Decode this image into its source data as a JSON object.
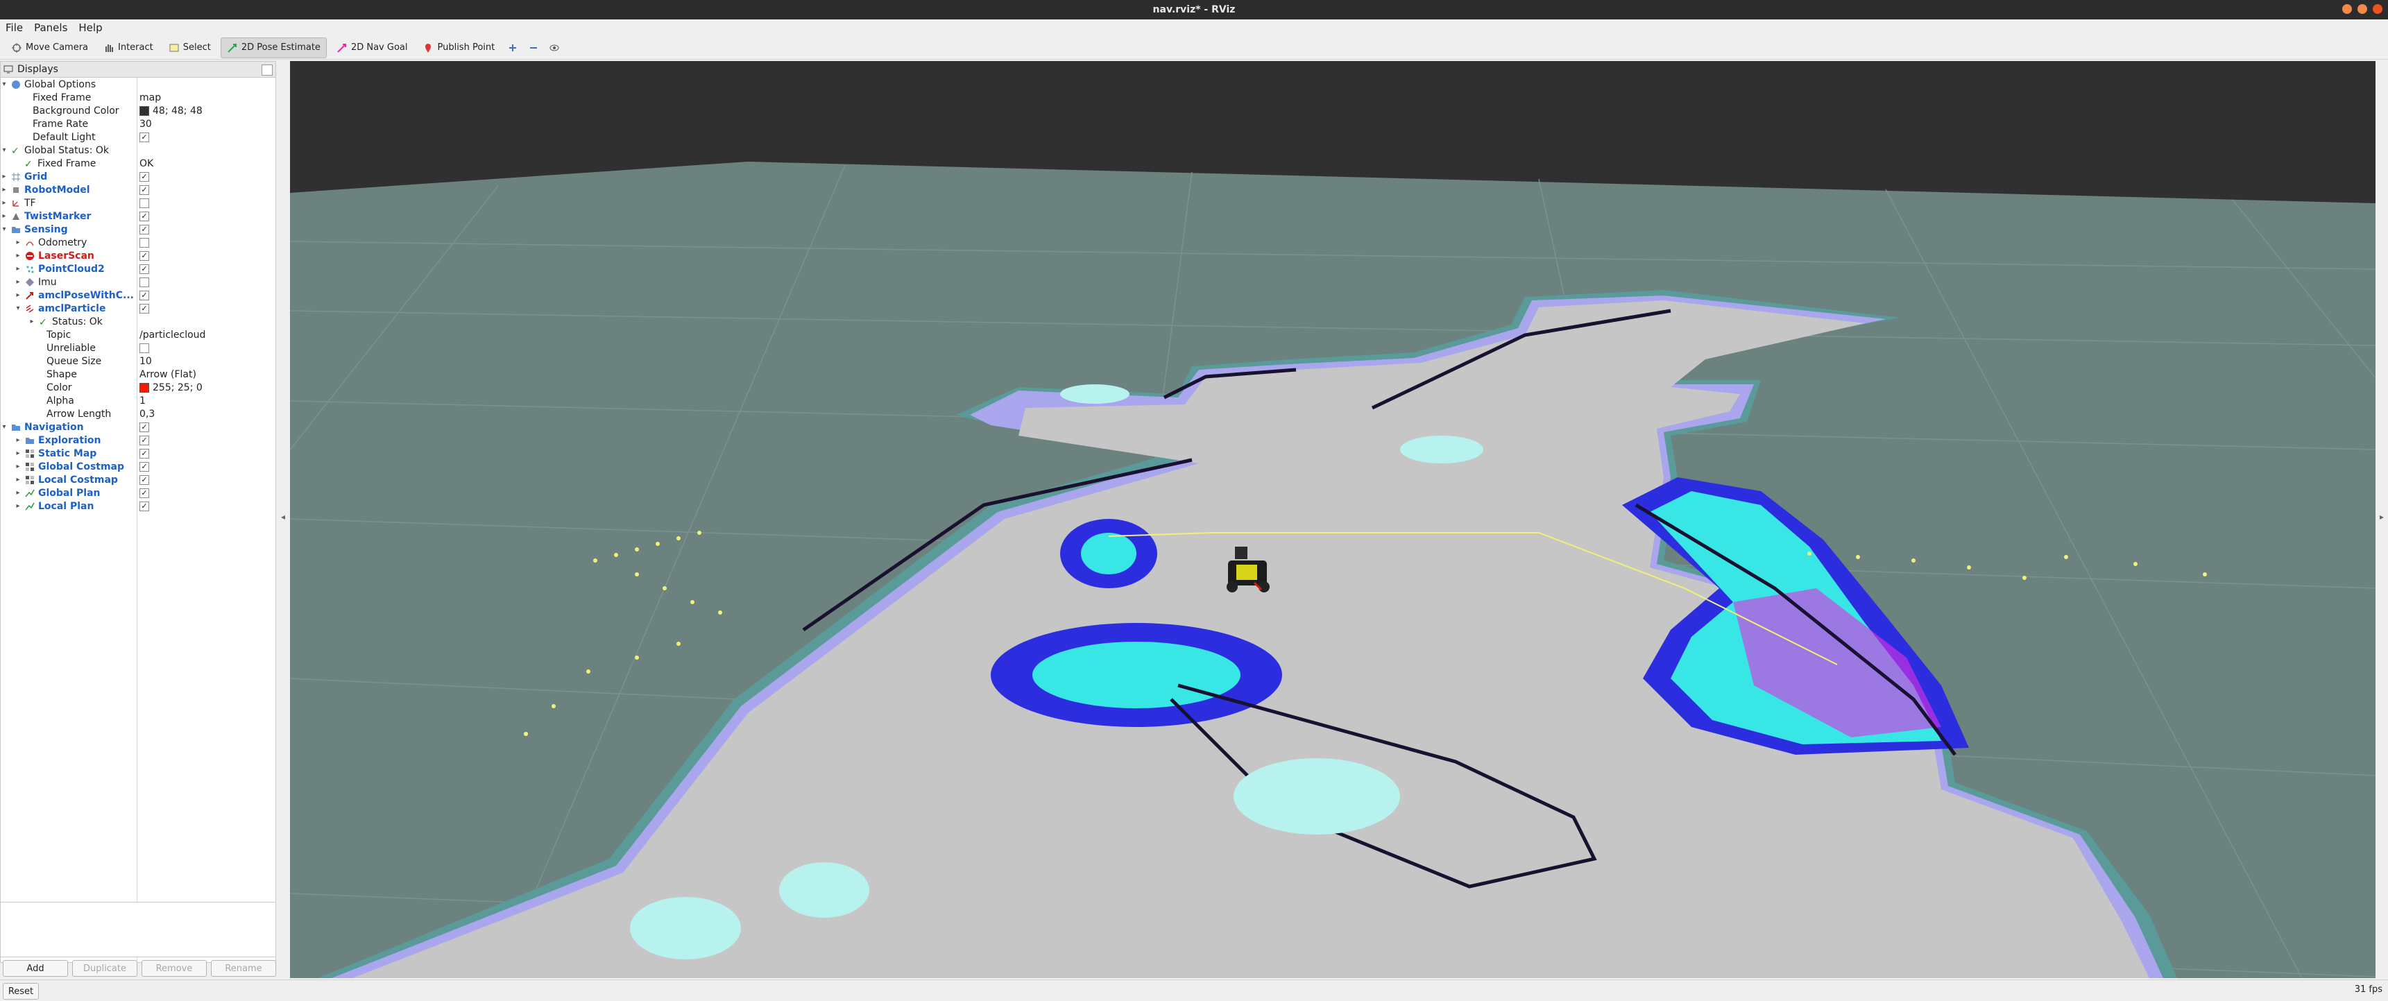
{
  "window": {
    "title": "nav.rviz* - RViz"
  },
  "menu": [
    "File",
    "Panels",
    "Help"
  ],
  "toolbar": {
    "move_camera": "Move Camera",
    "interact": "Interact",
    "select": "Select",
    "pose_estimate": "2D Pose Estimate",
    "nav_goal": "2D Nav Goal",
    "publish_point": "Publish Point"
  },
  "displays": {
    "title": "Displays",
    "rows": [
      {
        "name": "Global Options",
        "value": ""
      },
      {
        "name": "Fixed Frame",
        "value": "map"
      },
      {
        "name": "Background Color",
        "value": "48; 48; 48"
      },
      {
        "name": "Frame Rate",
        "value": "30"
      },
      {
        "name": "Default Light",
        "value": ""
      },
      {
        "name": "Global Status: Ok",
        "value": ""
      },
      {
        "name": "Fixed Frame",
        "value": "OK"
      },
      {
        "name": "Grid",
        "value": ""
      },
      {
        "name": "RobotModel",
        "value": ""
      },
      {
        "name": "TF",
        "value": ""
      },
      {
        "name": "TwistMarker",
        "value": ""
      },
      {
        "name": "Sensing",
        "value": ""
      },
      {
        "name": "Odometry",
        "value": ""
      },
      {
        "name": "LaserScan",
        "value": ""
      },
      {
        "name": "PointCloud2",
        "value": ""
      },
      {
        "name": "Imu",
        "value": ""
      },
      {
        "name": "amclPoseWithC...",
        "value": ""
      },
      {
        "name": "amclParticle",
        "value": ""
      },
      {
        "name": "Status: Ok",
        "value": ""
      },
      {
        "name": "Topic",
        "value": "/particlecloud"
      },
      {
        "name": "Unreliable",
        "value": ""
      },
      {
        "name": "Queue Size",
        "value": "10"
      },
      {
        "name": "Shape",
        "value": "Arrow (Flat)"
      },
      {
        "name": "Color",
        "value": "255; 25; 0"
      },
      {
        "name": "Alpha",
        "value": "1"
      },
      {
        "name": "Arrow Length",
        "value": "0,3"
      },
      {
        "name": "Navigation",
        "value": ""
      },
      {
        "name": "Exploration",
        "value": ""
      },
      {
        "name": "Static Map",
        "value": ""
      },
      {
        "name": "Global Costmap",
        "value": ""
      },
      {
        "name": "Local Costmap",
        "value": ""
      },
      {
        "name": "Global Plan",
        "value": ""
      },
      {
        "name": "Local Plan",
        "value": ""
      }
    ],
    "buttons": {
      "add": "Add",
      "duplicate": "Duplicate",
      "remove": "Remove",
      "rename": "Rename"
    }
  },
  "colors": {
    "background_swatch": "#303030",
    "particle_swatch": "#ff1900",
    "accent_blue": "#1d60c8",
    "viewport_floor": "#6b827e",
    "viewport_sky": "#303030"
  },
  "statusbar": {
    "reset": "Reset",
    "fps": "31 fps"
  }
}
